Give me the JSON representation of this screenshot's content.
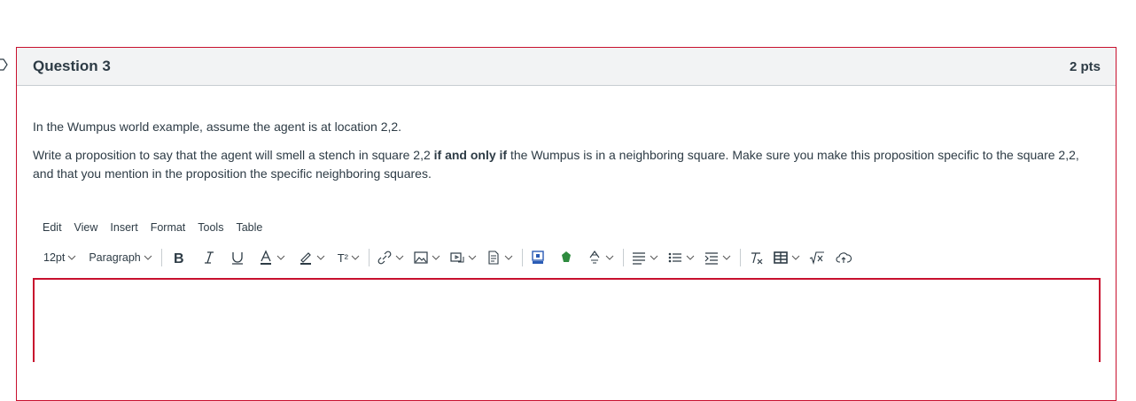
{
  "question": {
    "title": "Question 3",
    "points": "2 pts",
    "paragraph1": "In the Wumpus world example, assume the agent is at location 2,2.",
    "paragraph2_before": "Write a proposition to say that the agent will smell a stench in square 2,2 ",
    "paragraph2_bold": "if and only if",
    "paragraph2_after": " the Wumpus is in a neighboring square. Make sure you make this proposition specific to the square 2,2, and that you mention in the proposition the specific neighboring squares."
  },
  "editor": {
    "menu": [
      "Edit",
      "View",
      "Insert",
      "Format",
      "Tools",
      "Table"
    ],
    "font_size": "12pt",
    "block_format": "Paragraph",
    "superscript_label": "T²",
    "accent_color": "#c8102e"
  }
}
